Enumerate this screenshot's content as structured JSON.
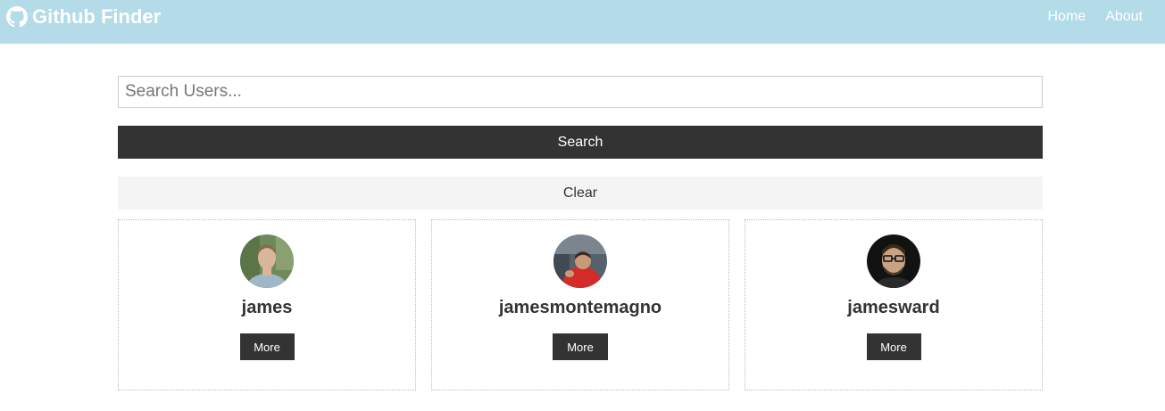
{
  "navbar": {
    "brand_title": "Github Finder",
    "brand_icon": "github-icon",
    "links": [
      {
        "label": "Home"
      },
      {
        "label": "About"
      }
    ]
  },
  "search": {
    "placeholder": "Search Users...",
    "value": ""
  },
  "buttons": {
    "search_label": "Search",
    "clear_label": "Clear"
  },
  "users": [
    {
      "login": "james",
      "more_label": "More",
      "avatar_colors": {
        "bg": "#6f8a5a",
        "skin": "#d9b59a",
        "shirt": "#9fb7c8",
        "hair": "#8a6a4a"
      }
    },
    {
      "login": "jamesmontemagno",
      "more_label": "More",
      "avatar_colors": {
        "bg": "#55616b",
        "skin": "#c99a7a",
        "shirt": "#d42a2a",
        "hair": "#3a2a20"
      }
    },
    {
      "login": "jamesward",
      "more_label": "More",
      "avatar_colors": {
        "bg": "#121212",
        "skin": "#c9a184",
        "shirt": "#2a2a2a",
        "hair": "#3a2a1a"
      }
    }
  ],
  "colors": {
    "navbar_bg": "#b3dbe8",
    "dark_button": "#333333",
    "light_button": "#f4f4f4"
  }
}
